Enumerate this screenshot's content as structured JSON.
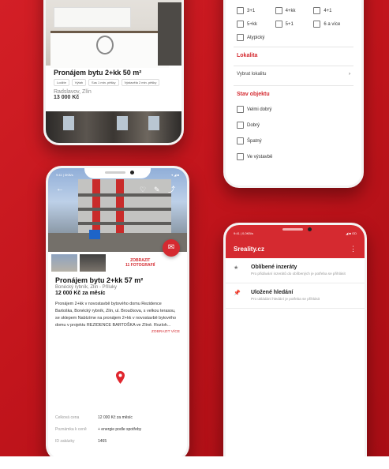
{
  "colors": {
    "brand": "#d52a30",
    "background": "#c2151c"
  },
  "listing_card": {
    "title": "Pronájem bytu 2+kk 50 m²",
    "tags": [
      "Lodžie",
      "Výtah",
      "Sus 1 min. pěšky",
      "Výstavěla 2 min. pěšky"
    ],
    "location": "Radslavov, Zlín",
    "price": "13 000 Kč"
  },
  "filters": {
    "dispositions": [
      "3+1",
      "4+kk",
      "4+1",
      "5+kk",
      "5+1",
      "6 a více",
      "Atypický"
    ],
    "locality_heading": "Lokalita",
    "locality_select": "Vybrat lokalitu",
    "state_heading": "Stav objektu",
    "states": [
      "Velmi dobrý",
      "Dobrý",
      "Špatný",
      "Ve výstavbě"
    ]
  },
  "detail": {
    "status_left": "9:41 | 0KB/s",
    "status_right": "▾ ◢ ■",
    "gallery_more": "ZOBRAZIT",
    "gallery_count": "11 FOTOGRAFIÍ",
    "title": "Pronájem bytu 2+kk 57 m²",
    "address": "Bonécký rybník, Zlín - Příluky",
    "price": "12 000 Kč za měsíc",
    "description": "Pronájem 2+kk v novostavbě bytového domu Rezidence Bartoška, Bonécký rybník, Zlín, ul. Broučkova, s velkou terasou, se sklepem Nabízíme na pronájem 2+kk v novostavbě bytového domu v projektu REZIDENCE BARTOŠKA ve Zlíně. Rozloh...",
    "show_more": "ZOBRAZIT VÍCE",
    "rows": [
      {
        "label": "Celková cena",
        "value": "12 000 Kč za měsíc"
      },
      {
        "label": "Poznámka k ceně",
        "value": "+ energie podle spotřeby"
      },
      {
        "label": "ID zakázky",
        "value": "1465"
      }
    ]
  },
  "drawer": {
    "status_left": "9:41 | 0,0KB/s",
    "status_right": "◢ ■ OD",
    "logo": "Sreality.cz",
    "items": [
      {
        "icon": "star-icon",
        "glyph": "★",
        "title": "Oblíbené inzeráty",
        "subtitle": "Pro přidávání inzerátů do oblíbených je potřeba se přihlásit"
      },
      {
        "icon": "pin-icon",
        "glyph": "📌",
        "title": "Uložené hledání",
        "subtitle": "Pro ukládání hledání je potřeba se přihlásit"
      }
    ]
  }
}
